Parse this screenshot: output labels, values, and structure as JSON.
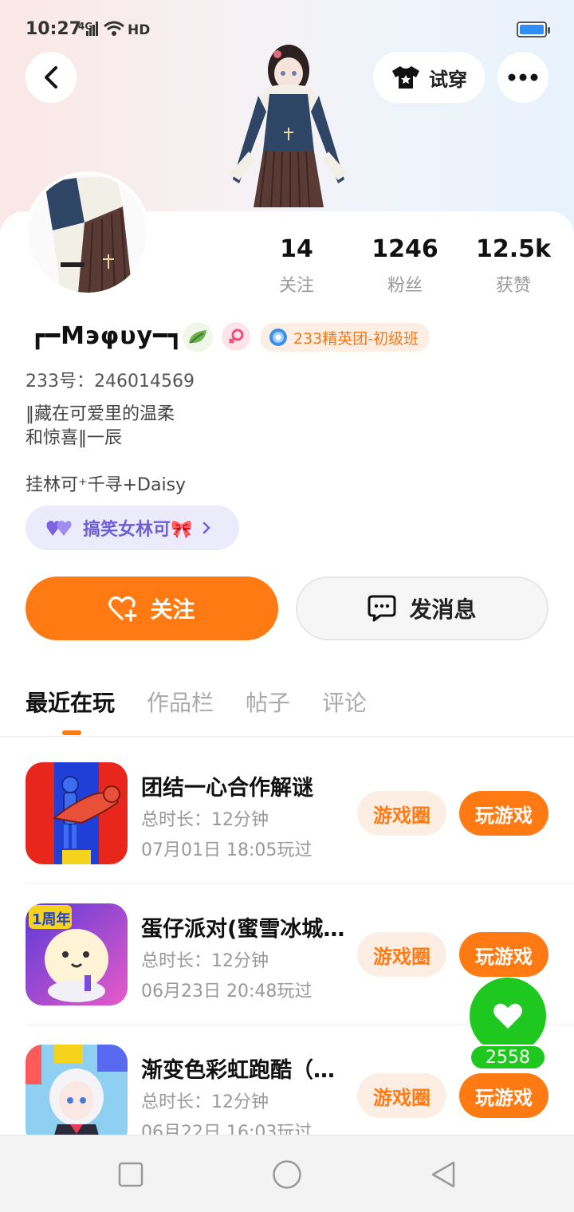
{
  "status_bar": {
    "time": "10:27",
    "network": "4G",
    "hd": "HD"
  },
  "header": {
    "tryon_label": "试穿"
  },
  "stats": [
    {
      "num": "14",
      "label": "关注"
    },
    {
      "num": "1246",
      "label": "粉丝"
    },
    {
      "num": "12.5k",
      "label": "获赞"
    }
  ],
  "profile": {
    "name": "┏━Мэφυу━┓",
    "badge_text": "233精英团-初级班",
    "uid": "233号：246014569",
    "bio_line1": "‖藏在可爱里的温柔",
    "bio_line2": "和惊喜‖一辰",
    "friends": "挂林可⁺千寻+Daisy",
    "tag_label": "搞笑女林可🎀"
  },
  "actions": {
    "follow_label": "关注",
    "message_label": "发消息"
  },
  "tabs": [
    "最近在玩",
    "作品栏",
    "帖子",
    "评论"
  ],
  "games": [
    {
      "title": "团结一心合作解谜",
      "duration": "总时长：12分钟",
      "played": "07月01日 18:05玩过",
      "circle_label": "游戏圈",
      "play_label": "玩游戏"
    },
    {
      "title": "蛋仔派对(蜜雪冰城…",
      "duration": "总时长：12分钟",
      "played": "06月23日 20:48玩过",
      "circle_label": "游戏圈",
      "play_label": "玩游戏",
      "thumb_badge": "1周年"
    },
    {
      "title": "渐变色彩虹跑酷（…",
      "duration": "总时长：12分钟",
      "played": "06月22日 16:03玩过",
      "circle_label": "游戏圈",
      "play_label": "玩游戏"
    }
  ],
  "like_count": "2558",
  "colors": {
    "accent": "#ff7a12",
    "like_green": "#1ec81e",
    "tag_purple": "#6e5fd6"
  }
}
